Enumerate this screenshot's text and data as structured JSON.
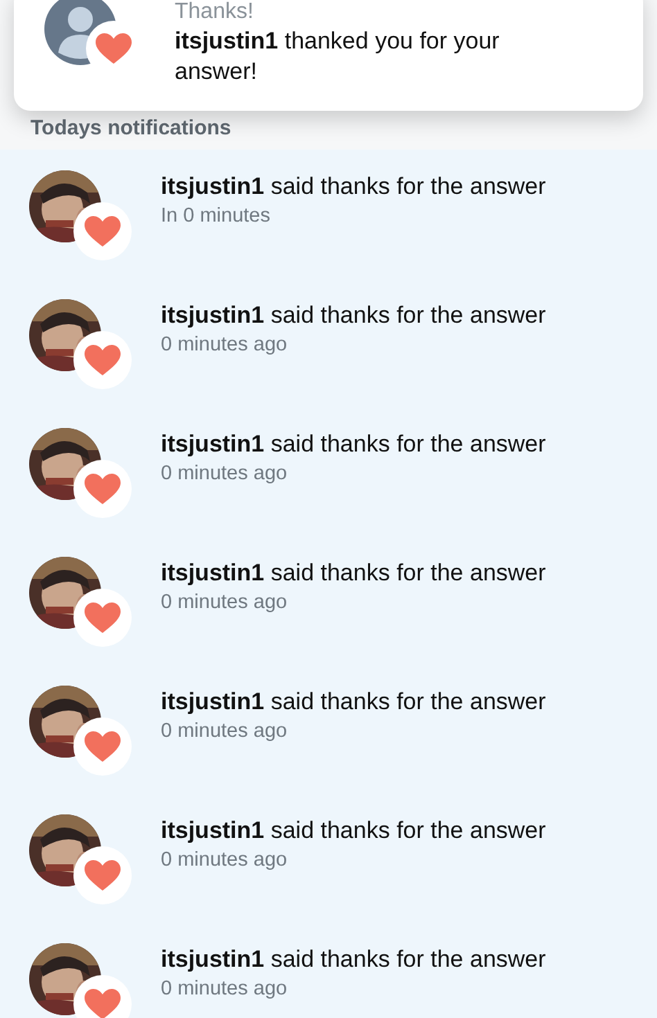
{
  "toast": {
    "title": "Thanks!",
    "message": "**itsjustin1** thanked you for your answer!"
  },
  "section": {
    "heading": "Todays notifications"
  },
  "notifications": [
    {
      "text": "**itsjustin1** said thanks for the answer",
      "time": "In 0 minutes"
    },
    {
      "text": "**itsjustin1** said thanks for the answer",
      "time": "0 minutes ago"
    },
    {
      "text": "**itsjustin1** said thanks for the answer",
      "time": "0 minutes ago"
    },
    {
      "text": "**itsjustin1** said thanks for the answer",
      "time": "0 minutes ago"
    },
    {
      "text": "**itsjustin1** said thanks for the answer",
      "time": "0 minutes ago"
    },
    {
      "text": "**itsjustin1** said thanks for the answer",
      "time": "0 minutes ago"
    },
    {
      "text": "**itsjustin1** said thanks for the answer",
      "time": "0 minutes ago"
    }
  ]
}
